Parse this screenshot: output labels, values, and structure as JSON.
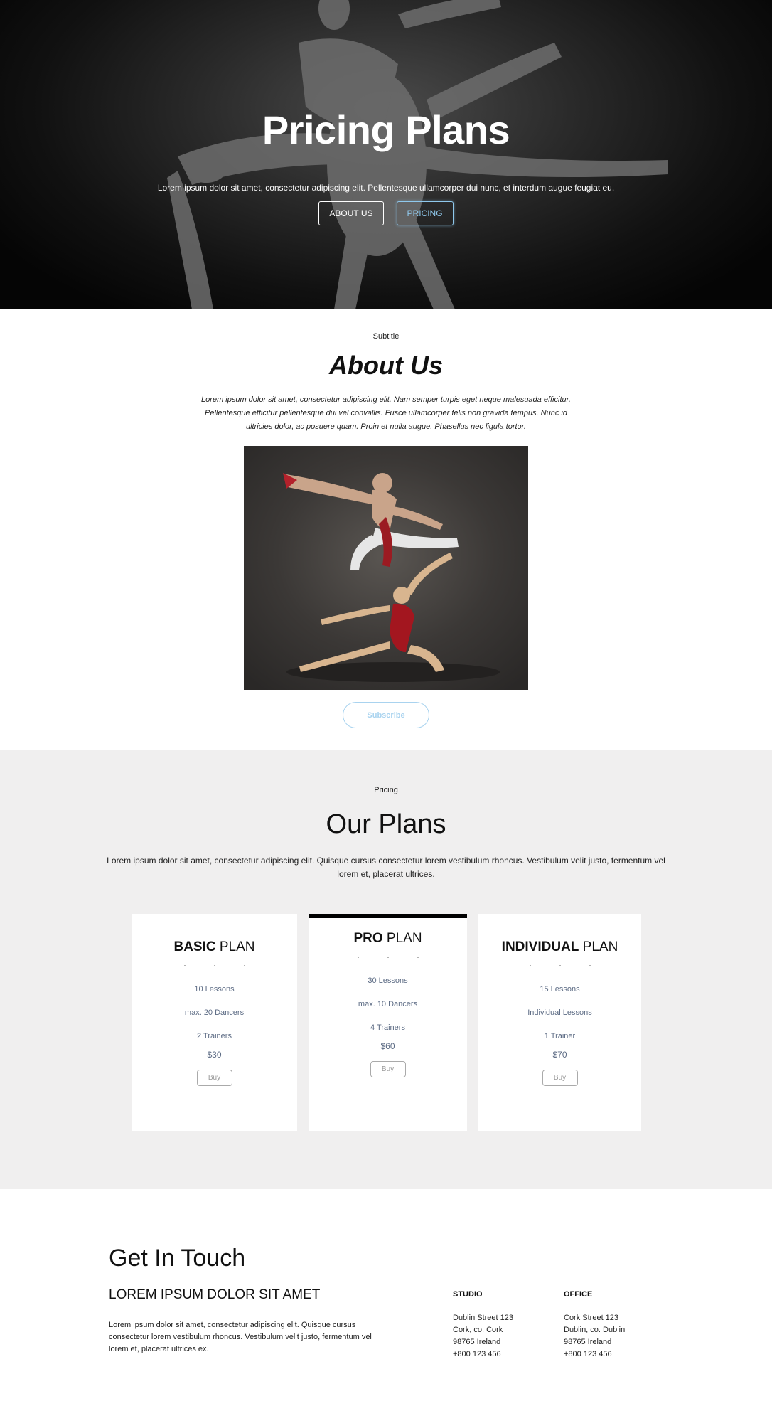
{
  "hero": {
    "title": "Pricing Plans",
    "subtitle": "Lorem ipsum dolor sit amet, consectetur adipiscing elit. Pellentesque ullamcorper dui nunc, et interdum augue feugiat eu.",
    "buttons": [
      "ABOUT US",
      "PRICING"
    ]
  },
  "about": {
    "subtitle": "Subtitle",
    "title": "About Us",
    "text": "Lorem ipsum dolor sit amet, consectetur adipiscing elit. Nam semper turpis eget neque malesuada efficitur. Pellentesque efficitur pellentesque dui vel convallis. Fusce ullamcorper felis non gravida tempus. Nunc id ultricies dolor, ac posuere quam. Proin et nulla augue. Phasellus nec ligula tortor.",
    "subscribe_label": "Subscribe"
  },
  "pricing": {
    "label": "Pricing",
    "title": "Our Plans",
    "description": "Lorem ipsum dolor sit amet, consectetur adipiscing elit. Quisque cursus consectetur lorem vestibulum rhoncus. Vestibulum velit justo, fermentum vel lorem et, placerat ultrices.",
    "plans": [
      {
        "name_bold": "BASIC",
        "name_rest": " PLAN",
        "features": [
          "10 Lessons",
          "max. 20 Dancers",
          "2 Trainers"
        ],
        "price": "$30",
        "button": "Buy"
      },
      {
        "name_bold": "PRO",
        "name_rest": " PLAN",
        "features": [
          "30 Lessons",
          "max. 10 Dancers",
          "4 Trainers"
        ],
        "price": "$60",
        "button": "Buy"
      },
      {
        "name_bold": "INDIVIDUAL",
        "name_rest": " PLAN",
        "features": [
          "15 Lessons",
          "Individual Lessons",
          "1 Trainer"
        ],
        "price": "$70",
        "button": "Buy"
      }
    ]
  },
  "contact": {
    "title": "Get In Touch",
    "heading": "LOREM IPSUM DOLOR SIT AMET",
    "text": "Lorem ipsum dolor sit amet, consectetur adipiscing elit. Quisque cursus consectetur lorem vestibulum rhoncus. Vestibulum velit justo, fermentum vel lorem et, placerat ultrices ex.",
    "studio": {
      "heading": "STUDIO",
      "lines": [
        "Dublin Street 123",
        "Cork, co. Cork",
        "98765 Ireland",
        "+800 123 456"
      ]
    },
    "office": {
      "heading": "OFFICE",
      "lines": [
        "Cork Street 123",
        "Dublin, co. Dublin",
        "98765 Ireland",
        "+800 123 456"
      ]
    }
  },
  "colors": {
    "accent": "#8fc8ec",
    "pricing_bg": "#f0efef",
    "feature_text": "#5c6b84"
  }
}
